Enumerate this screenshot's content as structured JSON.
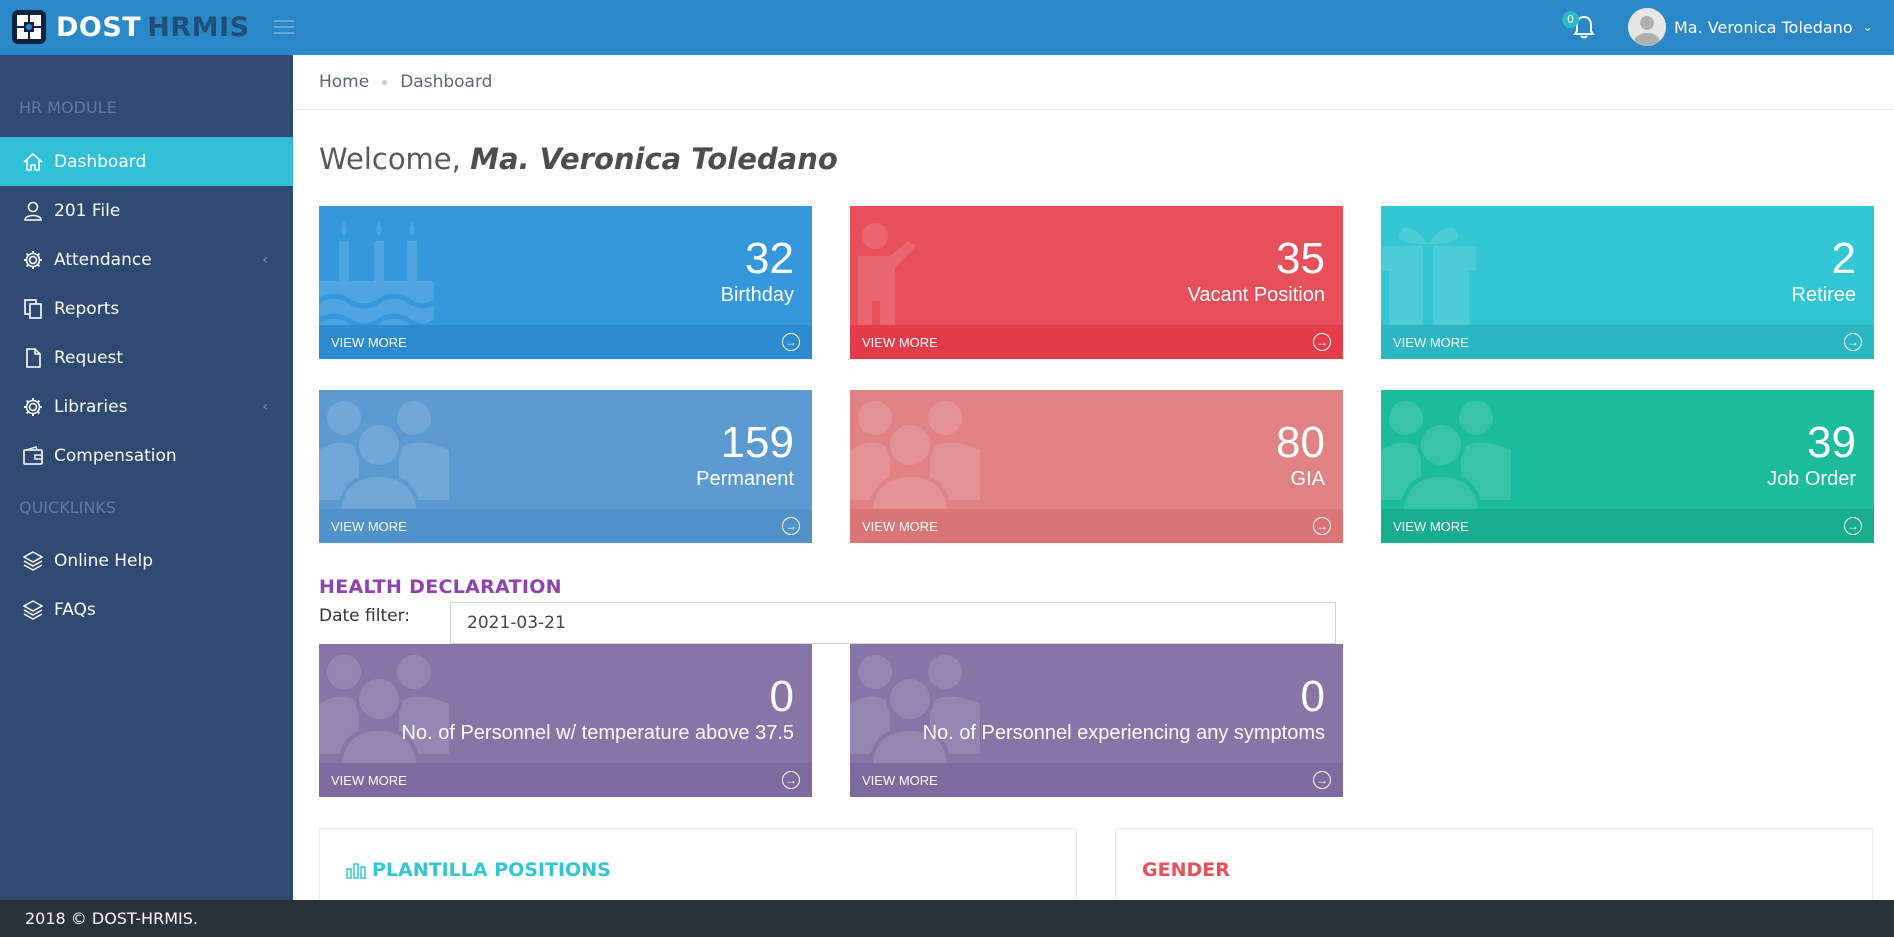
{
  "brand": {
    "main": "DOST",
    "sub": "HRMIS"
  },
  "topbar": {
    "notification_count": "0",
    "user_name": "Ma. Veronica Toledano"
  },
  "sidebar": {
    "section_hr": "HR MODULE",
    "section_quicklinks": "QUICKLINKS",
    "items": [
      {
        "label": "Dashboard",
        "icon": "home-icon",
        "active": true
      },
      {
        "label": "201 File",
        "icon": "user-icon"
      },
      {
        "label": "Attendance",
        "icon": "gear-icon",
        "has_children": true
      },
      {
        "label": "Reports",
        "icon": "copy-icon"
      },
      {
        "label": "Request",
        "icon": "file-icon"
      },
      {
        "label": "Libraries",
        "icon": "gear-icon",
        "has_children": true
      },
      {
        "label": "Compensation",
        "icon": "wallet-icon"
      }
    ],
    "quicklinks": [
      {
        "label": "Online Help",
        "icon": "layers-icon"
      },
      {
        "label": "FAQs",
        "icon": "layers-icon"
      }
    ]
  },
  "breadcrumb": {
    "home": "Home",
    "current": "Dashboard"
  },
  "welcome": {
    "prefix": "Welcome, ",
    "name": "Ma. Veronica Toledano"
  },
  "cards": [
    {
      "value": "32",
      "label": "Birthday",
      "color": "#3598dc",
      "icon": "cake-icon"
    },
    {
      "value": "35",
      "label": "Vacant Position",
      "color": "#e7505a",
      "icon": "person-wave-icon"
    },
    {
      "value": "2",
      "label": "Retiree",
      "color": "#32c5d2",
      "icon": "gift-icon"
    },
    {
      "value": "159",
      "label": "Permanent",
      "color": "#5c9bd1",
      "icon": "users-icon"
    },
    {
      "value": "80",
      "label": "GIA",
      "color": "#e08283",
      "icon": "users-icon"
    },
    {
      "value": "39",
      "label": "Job Order",
      "color": "#1bbc9b",
      "icon": "users-icon"
    }
  ],
  "view_more": "VIEW MORE",
  "health": {
    "title": "HEALTH DECLARATION",
    "date_label": "Date filter:",
    "date_value": "2021-03-21",
    "cards": [
      {
        "value": "0",
        "label": "No. of Personnel w/ temperature above 37.5",
        "color": "#8775a7"
      },
      {
        "value": "0",
        "label": "No. of Personnel experiencing any symptoms",
        "color": "#8775a7"
      }
    ]
  },
  "panels": {
    "plantilla": {
      "title": "PLANTILLA POSITIONS",
      "color": "#32c5d2"
    },
    "gender": {
      "title": "GENDER",
      "color": "#e7505a"
    }
  },
  "footer": {
    "text": "2018 © DOST-HRMIS."
  }
}
